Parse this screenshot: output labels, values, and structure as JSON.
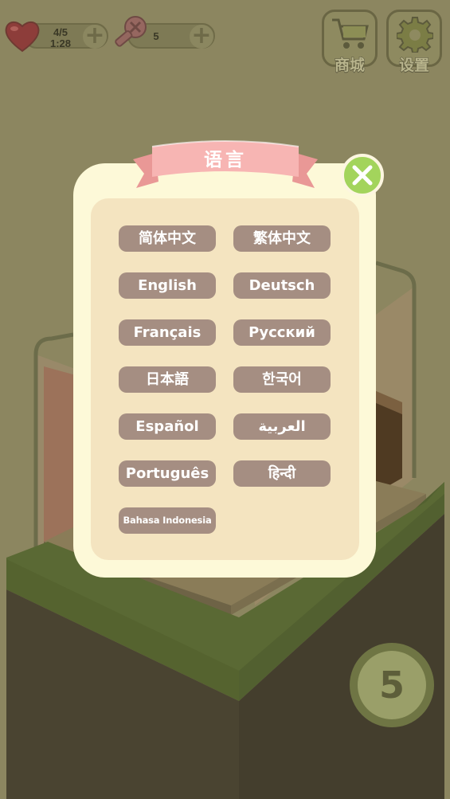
{
  "hud": {
    "lives": {
      "icon": "heart-icon",
      "count": "4/5",
      "timer": "1:28",
      "add_icon": "plus-icon"
    },
    "screws": {
      "icon": "screw-icon",
      "count": "5",
      "add_icon": "plus-icon"
    },
    "shop": {
      "icon": "shopping-cart-icon",
      "label": "商城"
    },
    "settings": {
      "icon": "gear-icon",
      "label": "设置"
    }
  },
  "dialog": {
    "title": "语言",
    "close_icon": "close-x-icon",
    "languages": [
      {
        "label": "简体中文"
      },
      {
        "label": "繁体中文"
      },
      {
        "label": "English"
      },
      {
        "label": "Deutsch"
      },
      {
        "label": "Français"
      },
      {
        "label": "Русский"
      },
      {
        "label": "日本語"
      },
      {
        "label": "한국어"
      },
      {
        "label": "Español"
      },
      {
        "label": "العربية"
      },
      {
        "label": "Português"
      },
      {
        "label": "हिन्दी"
      },
      {
        "label": "Bahasa Indonesia"
      }
    ]
  },
  "level": {
    "number": "5",
    "icon": "cat-face-icon"
  },
  "colors": {
    "ribbon": "#f7b5b3",
    "close_button": "#a3d45c",
    "language_button": "#a58e82",
    "dialog": "#fdf9d8",
    "dialog_inner": "#f4e4c0"
  }
}
